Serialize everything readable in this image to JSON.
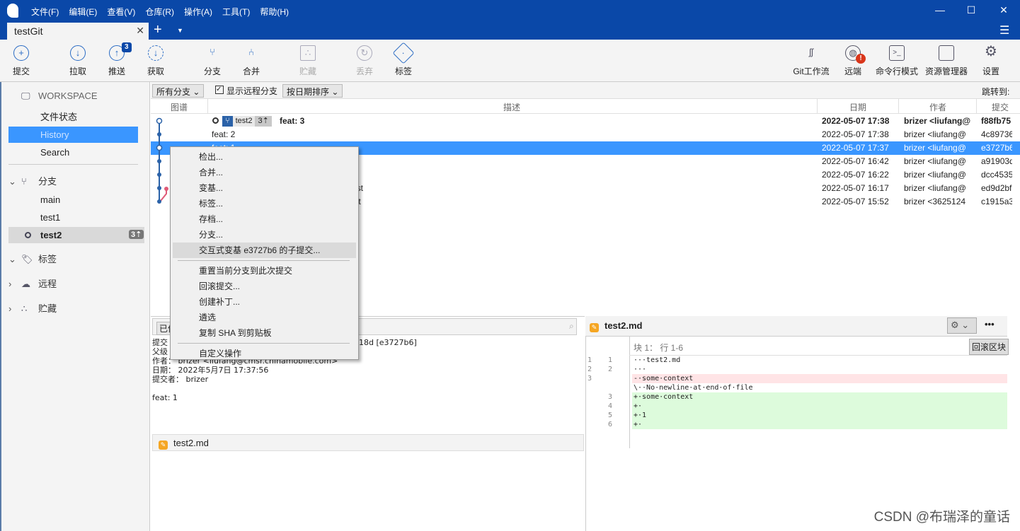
{
  "app": {
    "menu": [
      "文件(F)",
      "编辑(E)",
      "查看(V)",
      "仓库(R)",
      "操作(A)",
      "工具(T)",
      "帮助(H)"
    ],
    "tab": "testGit"
  },
  "toolbar": {
    "left": [
      {
        "label": "提交",
        "icon": "plus-circle-icon"
      },
      {
        "label": "拉取",
        "icon": "arrow-down-circle-icon"
      },
      {
        "label": "推送",
        "icon": "arrow-up-circle-icon",
        "badge": "3"
      },
      {
        "label": "获取",
        "icon": "fetch-icon"
      },
      {
        "label": "分支",
        "icon": "branch-icon"
      },
      {
        "label": "合并",
        "icon": "merge-icon"
      },
      {
        "label": "贮藏",
        "icon": "stash-icon"
      },
      {
        "label": "丢弃",
        "icon": "discard-icon"
      },
      {
        "label": "标签",
        "icon": "tag-icon"
      }
    ],
    "right": [
      {
        "label": "Git工作流",
        "icon": "git-flow-icon"
      },
      {
        "label": "远端",
        "icon": "globe-icon",
        "badge": "!"
      },
      {
        "label": "命令行模式",
        "icon": "terminal-icon"
      },
      {
        "label": "资源管理器",
        "icon": "folder-icon"
      },
      {
        "label": "设置",
        "icon": "gear-icon"
      }
    ]
  },
  "sidebar": {
    "workspace": "WORKSPACE",
    "items": [
      "文件状态",
      "History",
      "Search"
    ],
    "branches_label": "分支",
    "branches": [
      "main",
      "test1",
      "test2"
    ],
    "current_branch_badge": "3⇡",
    "tags_label": "标签",
    "remotes_label": "远程",
    "stash_label": "贮藏"
  },
  "filters": {
    "branch_filter": "所有分支",
    "show_remote": "显示远程分支",
    "sort": "按日期排序",
    "jump_to": "跳转到:"
  },
  "columns": {
    "graph": "图谱",
    "desc": "描述",
    "date": "日期",
    "author": "作者",
    "commit": "提交"
  },
  "head_branch_tag": {
    "name": "test2",
    "ahead": "3⇡"
  },
  "commits": [
    {
      "desc": "feat: 3",
      "date": "2022-05-07 17:38",
      "author": "brizer <liufang@",
      "hash": "f88fb75"
    },
    {
      "desc": "feat: 2",
      "date": "2022-05-07 17:38",
      "author": "brizer <liufang@",
      "hash": "4c89736"
    },
    {
      "desc": "feat: 1",
      "date": "2022-05-07 17:37",
      "author": "brizer <liufang@",
      "hash": "e3727b6"
    },
    {
      "desc": "",
      "date": "2022-05-07 16:42",
      "author": "brizer <liufang@",
      "hash": "a91903d"
    },
    {
      "desc": "",
      "date": "2022-05-07 16:22",
      "author": "brizer <liufang@",
      "hash": "dcc4535"
    },
    {
      "desc": "est",
      "date": "2022-05-07 16:17",
      "author": "brizer <liufang@",
      "hash": "ed9d2bf"
    },
    {
      "desc": "nit",
      "date": "2022-05-07 15:52",
      "author": "brizer <3625124",
      "hash": "c1915a3"
    }
  ],
  "context_menu": [
    "检出...",
    "合并...",
    "变基...",
    "标签...",
    "存档...",
    "分支...",
    "交互式变基 e3727b6 的子提交...",
    "重置当前分支到此次提交",
    "回滚提交...",
    "创建补丁...",
    "遴选",
    "复制 SHA 到剪贴板",
    "自定义操作"
  ],
  "details": {
    "tab": "已依",
    "lines": [
      "提交",
      "父级",
      "作者： brizer <liufang@cmsr.chinamobile.com>",
      "日期： 2022年5月7日 17:37:56",
      "提交者： brizer",
      "",
      "feat: 1"
    ],
    "hash_fragment": "18d [e3727b6]",
    "file": "test2.md"
  },
  "diff": {
    "file": "test2.md",
    "hunk": "块 1： 行 1-6",
    "revert_hunk": "回滚区块",
    "lines": [
      {
        "o": "1",
        "n": "1",
        "t": "···test2.md",
        "k": "ctx"
      },
      {
        "o": "2",
        "n": "2",
        "t": "···",
        "k": "ctx"
      },
      {
        "o": "3",
        "n": "",
        "t": "-·some·context",
        "k": "del"
      },
      {
        "o": "",
        "n": "",
        "t": "\\··No·newline·at·end·of·file",
        "k": "ctx"
      },
      {
        "o": "",
        "n": "3",
        "t": "+·some·context",
        "k": "add"
      },
      {
        "o": "",
        "n": "4",
        "t": "+·",
        "k": "add"
      },
      {
        "o": "",
        "n": "5",
        "t": "+·1",
        "k": "add"
      },
      {
        "o": "",
        "n": "6",
        "t": "+·",
        "k": "add"
      }
    ]
  },
  "watermark": "CSDN @布瑞泽的童话",
  "colors": {
    "titlebar": "#0a48a8",
    "selection": "#3a96ff",
    "graph": "#2b62a8",
    "graph_branch": "#e05a78"
  }
}
